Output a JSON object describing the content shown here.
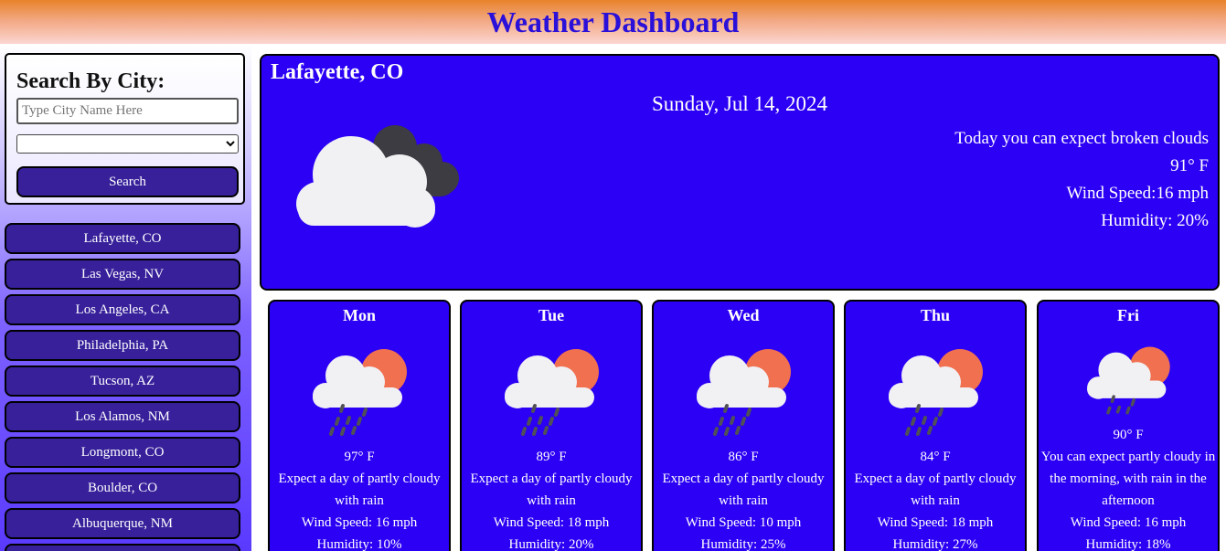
{
  "header": {
    "title": "Weather Dashboard"
  },
  "search": {
    "title": "Search By City:",
    "placeholder": "Type City Name Here",
    "select_value": "",
    "button_label": "Search"
  },
  "history": [
    "Lafayette, CO",
    "Las Vegas, NV",
    "Los Angeles, CA",
    "Philadelphia, PA",
    "Tucson, AZ",
    "Los Alamos, NM",
    "Longmont, CO",
    "Boulder, CO",
    "Albuquerque, NM"
  ],
  "current": {
    "city": "Lafayette, CO",
    "date": "Sunday, Jul 14, 2024",
    "icon": "broken-clouds-icon",
    "description": "Today you can expect broken clouds",
    "temp": "91° F",
    "wind": "Wind Speed:16 mph",
    "humidity": "Humidity: 20%"
  },
  "forecast": [
    {
      "day": "Mon",
      "icon": "partly-cloudy-rain-icon",
      "temp": "97° F",
      "desc": "Expect a day of partly cloudy with rain",
      "wind": "Wind Speed: 16 mph",
      "humidity": "Humidity: 10%"
    },
    {
      "day": "Tue",
      "icon": "partly-cloudy-rain-icon",
      "temp": "89° F",
      "desc": "Expect a day of partly cloudy with rain",
      "wind": "Wind Speed: 18 mph",
      "humidity": "Humidity: 20%"
    },
    {
      "day": "Wed",
      "icon": "partly-cloudy-rain-icon",
      "temp": "86° F",
      "desc": "Expect a day of partly cloudy with rain",
      "wind": "Wind Speed: 10 mph",
      "humidity": "Humidity: 25%"
    },
    {
      "day": "Thu",
      "icon": "partly-cloudy-rain-icon",
      "temp": "84° F",
      "desc": "Expect a day of partly cloudy with rain",
      "wind": "Wind Speed: 18 mph",
      "humidity": "Humidity: 27%"
    },
    {
      "day": "Fri",
      "icon": "partly-cloudy-rain-icon",
      "temp": "90° F",
      "desc": "You can expect partly cloudy in the morning, with rain in the afternoon",
      "wind": "Wind Speed: 16 mph",
      "humidity": "Humidity: 18%"
    }
  ],
  "colors": {
    "card_blue": "#2b00f4",
    "button_purple": "#37209a",
    "title_blue": "#2a10d8",
    "sun_orange": "#f07050"
  }
}
